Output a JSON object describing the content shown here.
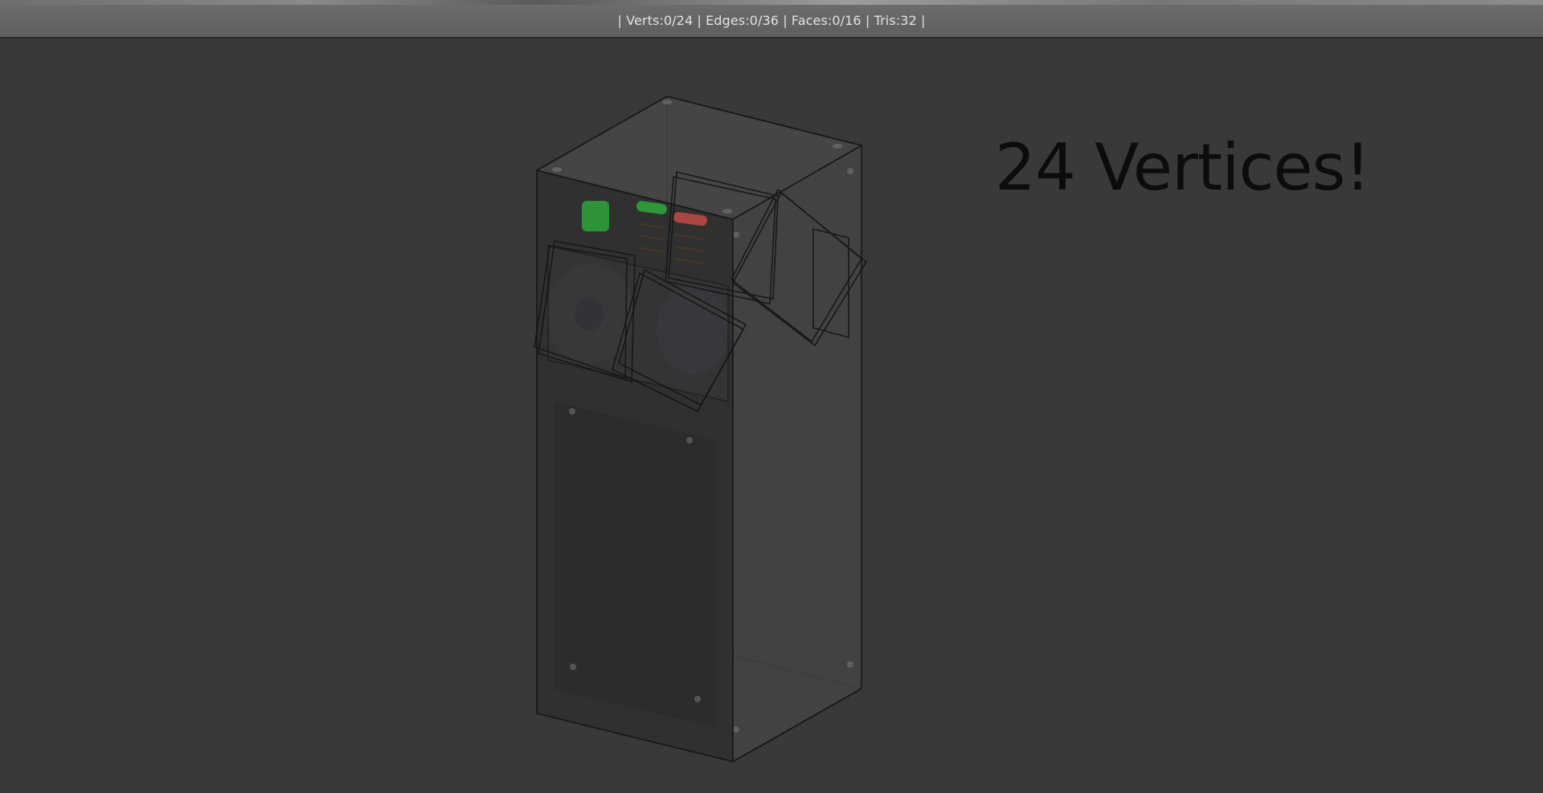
{
  "header": {
    "stats_text": "| Verts:0/24 | Edges:0/36 | Faces:0/16 | Tris:32 |"
  },
  "viewport": {
    "annotation_text": "24 Vertices!",
    "background_color": "#393939",
    "annotation_color": "#0c0c0c",
    "object": "speaker-cabinet-mesh",
    "indicator_colors": [
      "#2fa33a",
      "#c24a45"
    ]
  }
}
